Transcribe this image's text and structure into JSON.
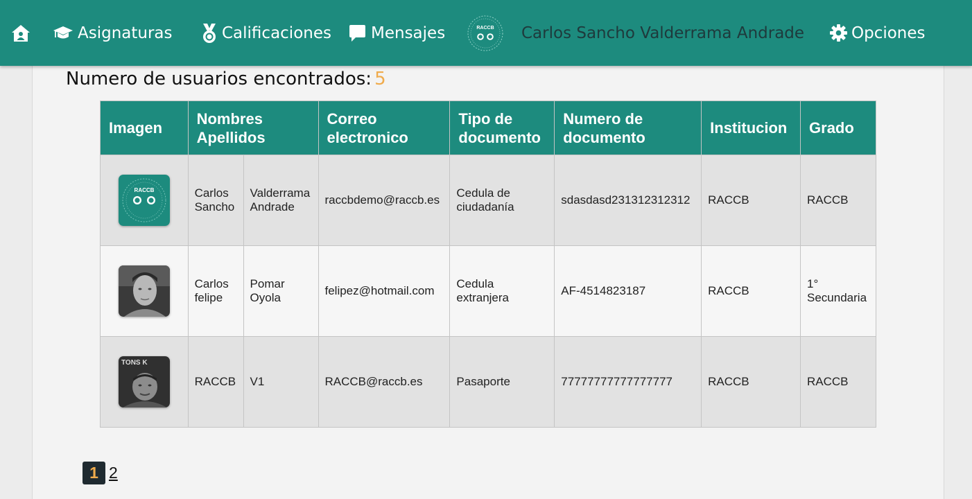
{
  "nav": {
    "home_icon": "home-icon",
    "asignaturas": "Asignaturas",
    "calificaciones": "Calificaciones",
    "mensajes": "Mensajes",
    "logo_text": "RACCB",
    "user_name": "Carlos Sancho Valderrama Andrade",
    "opciones": "Opciones",
    "accent": "#1d8b7e"
  },
  "results": {
    "label": "Numero de usuarios encontrados:",
    "count": "5",
    "count_color": "#f0ab4c"
  },
  "table": {
    "headers": {
      "imagen": "Imagen",
      "nombres_1": "Nombres",
      "nombres_2": "Apellidos",
      "correo_1": "Correo",
      "correo_2": "electronico",
      "tipo_1": "Tipo de",
      "tipo_2": "documento",
      "numero_1": "Numero de",
      "numero_2": "documento",
      "institucion": "Institucion",
      "grado": "Grado"
    },
    "rows": [
      {
        "avatar": "raccb-logo-avatar",
        "avatar_text": "RACCB",
        "nombres_1": "Carlos",
        "nombres_2": "Sancho",
        "apellidos_1": "Valderrama",
        "apellidos_2": "Andrade",
        "correo": "raccbdemo@raccb.es",
        "tipo_1": "Cedula de",
        "tipo_2": "ciudadanía",
        "numero": "sdasdasd231312312312",
        "institucion": "RACCB",
        "grado_1": "RACCB",
        "grado_2": ""
      },
      {
        "avatar": "user-photo-avatar",
        "avatar_text": "",
        "nombres_1": "Carlos",
        "nombres_2": "felipe",
        "apellidos_1": "Pomar",
        "apellidos_2": "Oyola",
        "correo": "felipez@hotmail.com",
        "tipo_1": "Cedula",
        "tipo_2": "extranjera",
        "numero": "AF-4514823187",
        "institucion": "RACCB",
        "grado_1": "1°",
        "grado_2": "Secundaria"
      },
      {
        "avatar": "user-photo-avatar",
        "avatar_text": "TONS K",
        "nombres_1": "RACCB",
        "nombres_2": "",
        "apellidos_1": "V1",
        "apellidos_2": "",
        "correo": "RACCB@raccb.es",
        "tipo_1": "Pasaporte",
        "tipo_2": "",
        "numero": "77777777777777777",
        "institucion": "RACCB",
        "grado_1": "RACCB",
        "grado_2": ""
      }
    ]
  },
  "pagination": {
    "current": "1",
    "next": "2"
  }
}
